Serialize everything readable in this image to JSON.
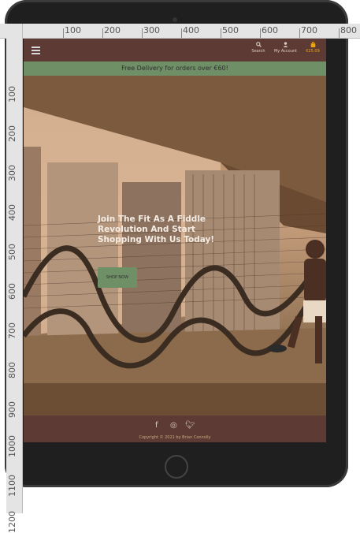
{
  "ruler": {
    "top_labels": [
      "100",
      "200",
      "300",
      "400",
      "500",
      "600",
      "700",
      "800"
    ],
    "left_labels": [
      "100",
      "200",
      "300",
      "400",
      "500",
      "600",
      "700",
      "800",
      "900",
      "1000",
      "1100",
      "1200"
    ]
  },
  "nav": {
    "search_label": "Search",
    "account_label": "My Account",
    "bag_total": "€25.09",
    "menu_icon": "hamburger-icon",
    "search_icon": "search-icon",
    "account_icon": "user-icon",
    "bag_icon": "shopping-bag-icon"
  },
  "promo": {
    "text": "Free Delivery for orders over €60!"
  },
  "hero": {
    "title": "Join The Fit As A Fiddle Revolution And Start Shopping With Us Today!",
    "button_label": "SHOP NOW"
  },
  "footer": {
    "social_icons": [
      "facebook-icon",
      "instagram-icon",
      "twitter-icon"
    ],
    "copyright": "Copyright © 2021 by Brian Connolly"
  },
  "colors": {
    "brand_brown": "#5d3b34",
    "promo_green": "#6f8f66",
    "bag_orange": "#f0a500"
  }
}
